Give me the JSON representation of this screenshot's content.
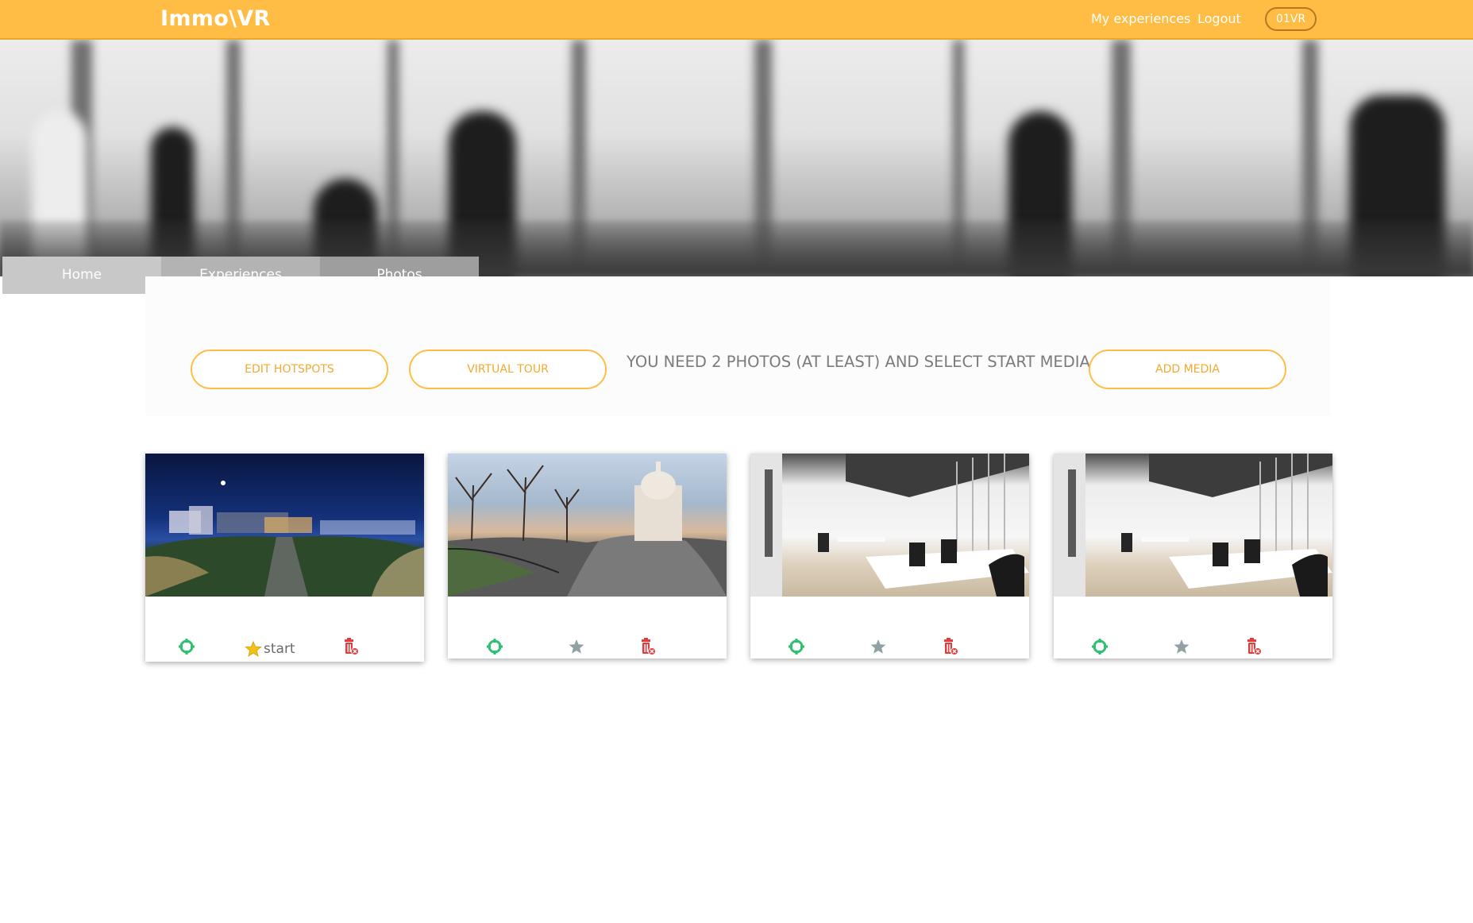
{
  "navbar": {
    "brand": "Immo\\VR",
    "my_experiences": "My experiences",
    "logout": "Logout",
    "user": "01VR"
  },
  "tabs": [
    "Home",
    "Experiences",
    "Photos"
  ],
  "actions": {
    "edit_hotspots": "EDIT HOTSPOTS",
    "virtual_tour": "VIRTUAL TOUR",
    "message": "YOU NEED 2 PHOTOS (AT LEAST) AND SELECT START MEDIA",
    "add_media": "ADD MEDIA"
  },
  "cards": [
    {
      "scene": "night-city-panorama",
      "is_start": true,
      "start_label": "start"
    },
    {
      "scene": "sacre-coeur-panorama",
      "is_start": false
    },
    {
      "scene": "office-panorama",
      "is_start": false
    },
    {
      "scene": "office-panorama",
      "is_start": false
    }
  ],
  "colors": {
    "navbar": "#ffbd45",
    "accent": "#ffbd45",
    "target_icon": "#2fbf71",
    "star_active": "#f3c017",
    "star_inactive": "#8fa1a5",
    "delete_icon": "#e63b3b"
  },
  "icons": {
    "target": "target-icon",
    "star": "star-icon",
    "delete": "trash-icon"
  }
}
